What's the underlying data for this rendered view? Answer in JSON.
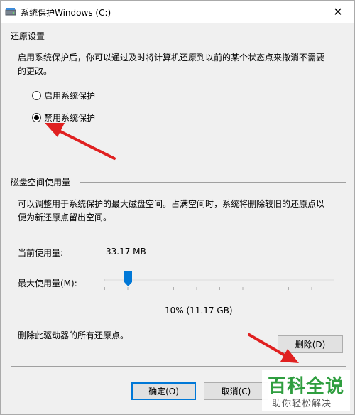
{
  "window": {
    "title": "系统保护Windows (C:)",
    "close_symbol": "✕"
  },
  "restore_settings": {
    "title": "还原设置",
    "description_line1": "启用系统保护后，你可以通过及时将计算机还原到以前的某个状态点来撤消不需要",
    "description_line2": "的更改。",
    "options": [
      {
        "label": "启用系统保护",
        "selected": false
      },
      {
        "label": "禁用系统保护",
        "selected": true
      }
    ]
  },
  "disk_usage": {
    "title": "磁盘空间使用量",
    "description_line1": "可以调整用于系统保护的最大磁盘空间。占满空间时，系统将删除较旧的还原点以",
    "description_line2": "便为新还原点留出空间。",
    "current_label": "当前使用量:",
    "current_value": "33.17 MB",
    "max_label": "最大使用量(M):",
    "max_percent_text": "10% (11.17 GB)",
    "max_fraction": 0.1
  },
  "delete": {
    "description": "删除此驱动器的所有还原点。",
    "button_label": "删除(D)"
  },
  "footer": {
    "ok_label": "确定(O)",
    "cancel_label": "取消(C)"
  },
  "watermark": {
    "main": "百科全说",
    "sub": "助你轻松解决"
  },
  "colors": {
    "arrow": "#e02020",
    "watermark_green": "#2f9e3f",
    "focus_border": "#0078d7"
  }
}
